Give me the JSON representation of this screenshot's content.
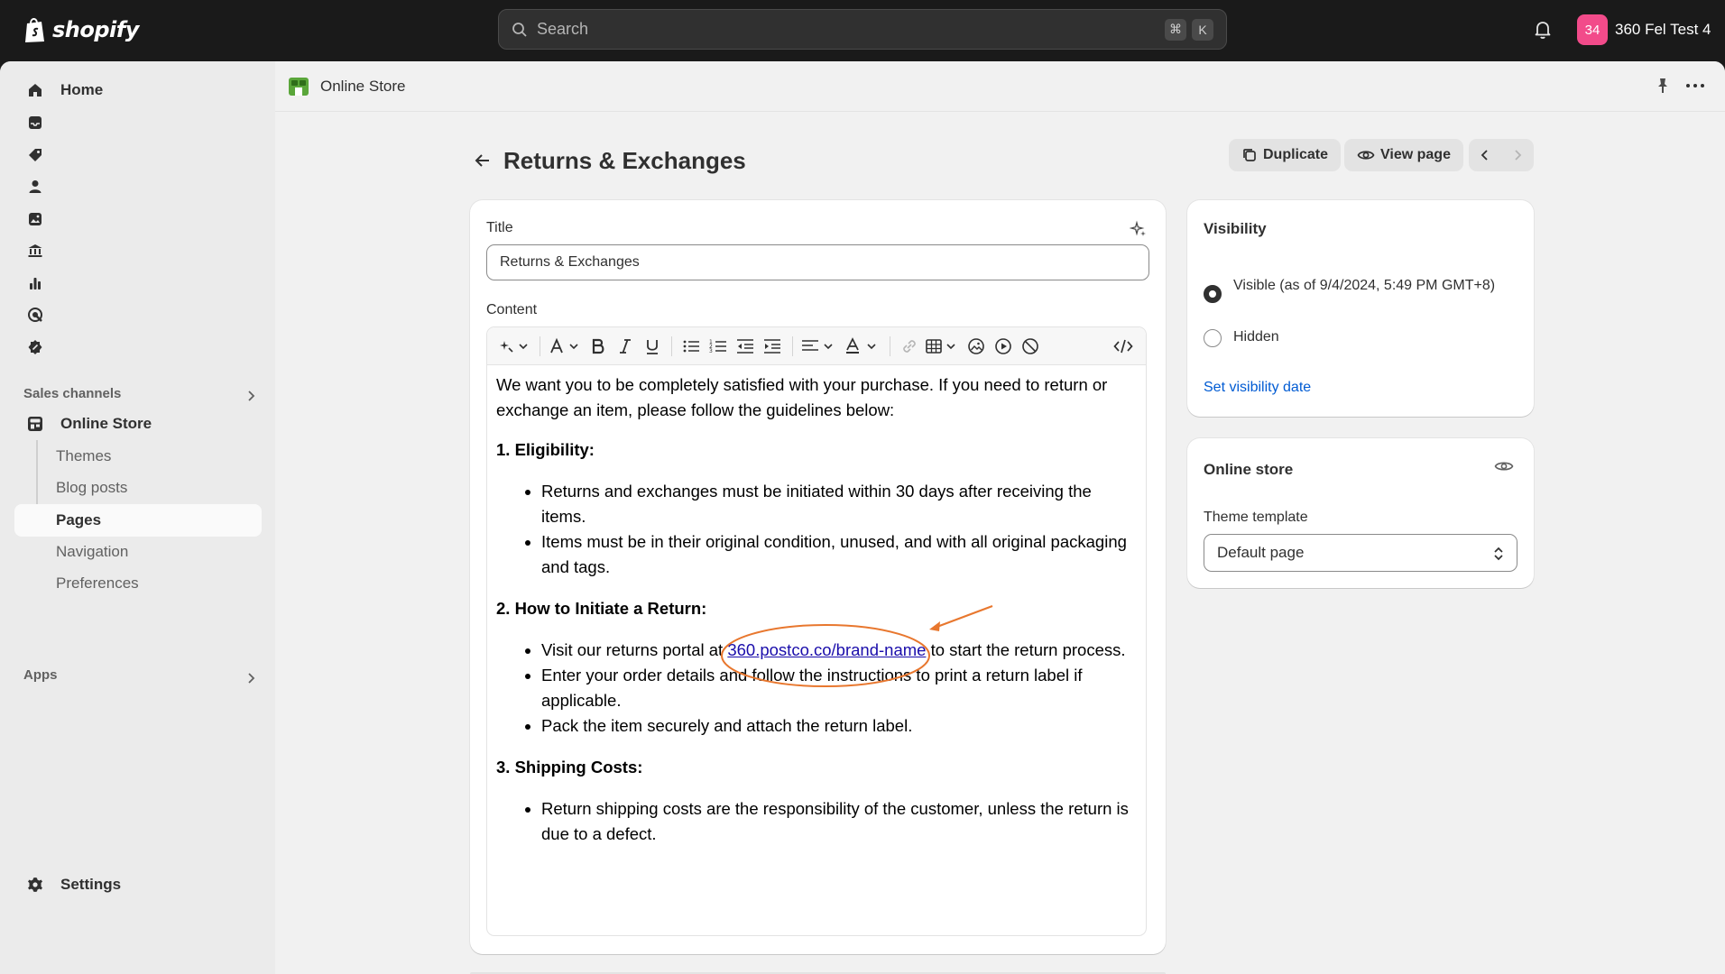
{
  "topbar": {
    "logo_text": "shopify",
    "search_placeholder": "Search",
    "shortcut_keys": [
      "⌘",
      "K"
    ],
    "store_avatar": "34",
    "store_name": "360 Fel Test 4"
  },
  "sidebar": {
    "home_label": "Home",
    "icon_items": [
      "inbox-icon",
      "tag-icon",
      "person-icon",
      "image-icon",
      "bank-icon",
      "chart-icon",
      "target-icon",
      "discount-icon"
    ],
    "sales_channels_label": "Sales channels",
    "online_store_label": "Online Store",
    "sub_items": [
      "Themes",
      "Blog posts",
      "Pages",
      "Navigation",
      "Preferences"
    ],
    "active_sub": "Pages",
    "apps_label": "Apps",
    "settings_label": "Settings"
  },
  "pagebar": {
    "title": "Online Store"
  },
  "header": {
    "title": "Returns & Exchanges",
    "duplicate_label": "Duplicate",
    "view_page_label": "View page"
  },
  "form": {
    "title_label": "Title",
    "title_value": "Returns & Exchanges",
    "content_label": "Content",
    "content": {
      "intro": "We want you to be completely satisfied with your purchase. If you need to return or exchange an item, please follow the guidelines below:",
      "h1": "1. Eligibility:",
      "e1": "Returns and exchanges must be initiated within 30 days after receiving the items.",
      "e2": "Items must be in their original condition, unused, and with all original packaging and tags.",
      "h2": "2. How to Initiate a Return:",
      "r1_before": "Visit our returns portal at ",
      "r1_link": "360.postco.co/brand-name",
      "r1_after": " to start the return process.",
      "r2": "Enter your order details and follow the instructions to print a return label if applicable.",
      "r3": "Pack the item securely and attach the return label.",
      "h3": "3. Shipping Costs:",
      "s1": "Return shipping costs are the responsibility of the customer, unless the return is due to a defect."
    }
  },
  "visibility": {
    "heading": "Visibility",
    "visible_label": "Visible (as of 9/4/2024, 5:49 PM GMT+8)",
    "hidden_label": "Hidden",
    "selected": "Visible",
    "set_date_link": "Set visibility date"
  },
  "online_store_card": {
    "heading": "Online store",
    "template_label": "Theme template",
    "template_value": "Default page"
  },
  "colors": {
    "topbar": "#1a1a1a",
    "avatar": "#f24b8a",
    "link": "#005bd3",
    "annotation": "#e8772e"
  }
}
